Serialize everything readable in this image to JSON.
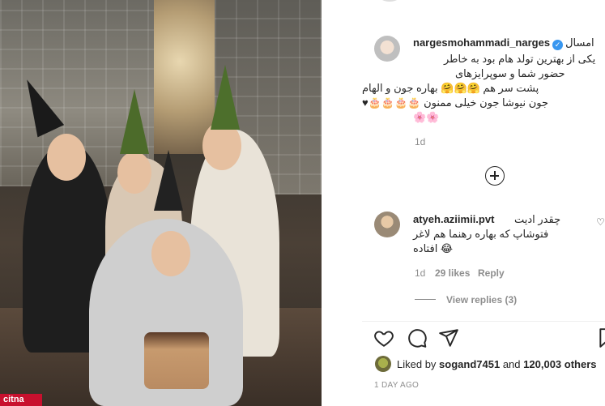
{
  "photo": {
    "watermark": "citna"
  },
  "post": {
    "username": "nargesmohammadi_narges",
    "caption_head_word": "امسال",
    "caption_lines": [
      "یکی از بهترین تولد هام بود به خاطر",
      "حضور شما و سوپرایزهای",
      "پشت سر هم 🤗🤗🤗 بهاره جون و الهام",
      "جون نیوشا جون خیلی ممنون 🎂🎂🎂🎂♥",
      "🌸🌸"
    ],
    "caption_time": "1d"
  },
  "comment": {
    "username": "atyeh.aziimii.pvt",
    "line1": "چقدر ادیت",
    "line2": "فتوشاپ که بهاره رهنما هم لاغر",
    "line3": "افتاده 😂",
    "time": "1d",
    "likes": "29 likes",
    "reply": "Reply",
    "view_replies": "View replies (3)"
  },
  "likes": {
    "prefix": "Liked by",
    "user": "sogand7451",
    "middle": "and",
    "count": "120,003 others"
  },
  "posted_ago": "1 DAY AGO",
  "icons": {
    "verified": "verified-badge-icon",
    "add": "plus-circle-icon",
    "like": "heart-icon",
    "comment": "comment-bubble-icon",
    "share": "paper-plane-icon",
    "save": "bookmark-icon"
  },
  "colors": {
    "verified": "#3897f0",
    "muted": "#8e8e8e",
    "text": "#262626"
  }
}
